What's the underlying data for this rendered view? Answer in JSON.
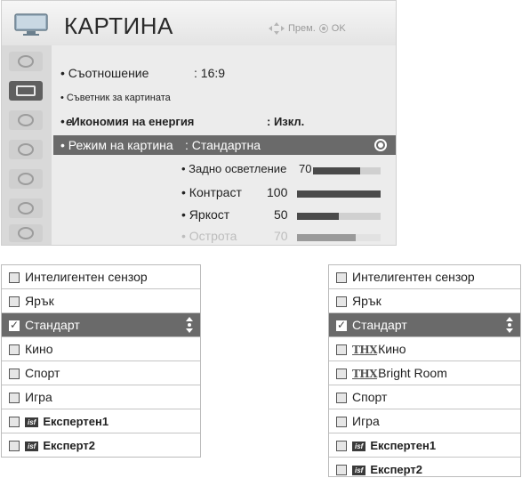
{
  "menu": {
    "title": "КАРТИНА",
    "hint_move": "Прем.",
    "hint_ok": "OK",
    "sidebar_icons": [
      "tv-antenna-icon",
      "picture-monitor-icon",
      "audio-speaker-icon",
      "clock-icon",
      "lock-icon",
      "options-icon",
      "network-icon"
    ],
    "items": {
      "aspect_label": "• Съотношение",
      "aspect_value": ": 16:9",
      "wizard_label": "• Съветник за картината",
      "energy_prefix": "• e",
      "energy_label": "Икономия на енергия",
      "energy_value": ": Изкл.",
      "mode_label": "• Режим на картина",
      "mode_value": ": Стандартна"
    },
    "sliders": [
      {
        "label": "• Задно осветление",
        "value": "70",
        "level": 70
      },
      {
        "label": "• Контраст",
        "value": "100",
        "level": 100
      },
      {
        "label": "• Яркост",
        "value": "50",
        "level": 50
      },
      {
        "label": "• Острота",
        "value": "70",
        "level": 70
      }
    ]
  },
  "list_left": {
    "items": [
      {
        "label": "Интелигентен сензор"
      },
      {
        "label": "Ярък"
      },
      {
        "label": "Стандарт",
        "selected": true
      },
      {
        "label": "Кино"
      },
      {
        "label": "Спорт"
      },
      {
        "label": "Игра"
      },
      {
        "label": "Експертен1",
        "badge": "isf"
      },
      {
        "label": "Експерт2",
        "badge": "isf"
      }
    ]
  },
  "list_right": {
    "items": [
      {
        "label": "Интелигентен сензор"
      },
      {
        "label": "Ярък"
      },
      {
        "label": "Стандарт",
        "selected": true
      },
      {
        "label": "Кино",
        "badge": "THX"
      },
      {
        "label": "Bright Room",
        "badge": "THX"
      },
      {
        "label": "Спорт"
      },
      {
        "label": "Игра"
      },
      {
        "label": "Експертен1",
        "badge": "isf"
      },
      {
        "label": "Експерт2",
        "badge": "isf"
      }
    ]
  },
  "colors": {
    "panel_bg": "#ececec",
    "highlight": "#6a6a6a",
    "bar_fill": "#4a4a4a"
  }
}
